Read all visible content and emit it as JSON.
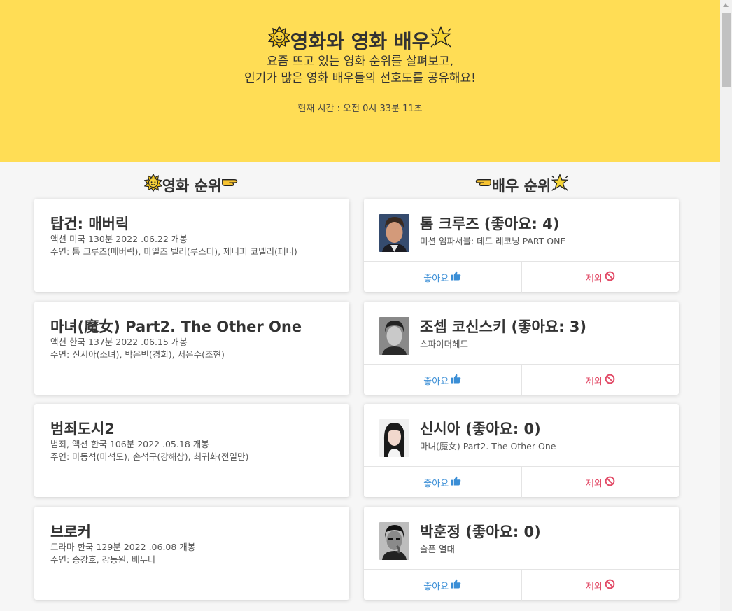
{
  "header": {
    "title": "영화와 영화 배우",
    "subtitle_line1": "요즘 뜨고 있는 영화 순위를 살펴보고,",
    "subtitle_line2": "인기가 많은 영화 배우들의 선호도를 공유해요!",
    "time_text": "현재 시간 : 오전 0시 33분 11초"
  },
  "movie_section": {
    "title": "영화 순위"
  },
  "actor_section": {
    "title": "배우 순위"
  },
  "movies": [
    {
      "title": "탑건: 매버릭",
      "info": "액션 미국 130분 2022 .06.22 개봉",
      "cast": "주연: 톰 크루즈(매버릭), 마일즈 텔러(루스터), 제니퍼 코넬리(페니)"
    },
    {
      "title": "마녀(魔女) Part2. The Other One",
      "info": "액션 한국 137분 2022 .06.15 개봉",
      "cast": "주연: 신시아(소녀), 박은빈(경희), 서은수(조현)"
    },
    {
      "title": "범죄도시2",
      "info": "범죄, 액션 한국 106분 2022 .05.18 개봉",
      "cast": "주연: 마동석(마석도), 손석구(강해상), 최귀화(전일만)"
    },
    {
      "title": "브로커",
      "info": "드라마 한국 129분 2022 .06.08 개봉",
      "cast": "주연: 송강호, 강동원, 배두나"
    }
  ],
  "actors": [
    {
      "name": "톰 크루즈 (좋아요: 4)",
      "movie": "미션 임파서블: 데드 레코닝 PART ONE"
    },
    {
      "name": "조셉 코신스키 (좋아요: 3)",
      "movie": "스파이더헤드"
    },
    {
      "name": "신시아 (좋아요: 0)",
      "movie": "마녀(魔女) Part2. The Other One"
    },
    {
      "name": "박훈정 (좋아요: 0)",
      "movie": "슬픈 열대"
    }
  ],
  "buttons": {
    "like_label": "좋아요",
    "exclude_label": "제외"
  },
  "icons": {
    "sun": "sun-face-icon",
    "star": "glowing-star-icon",
    "hand": "pointing-hand-icon",
    "like": "thumbs-up-icon",
    "exclude": "prohibited-icon"
  },
  "colors": {
    "hero_bg": "#ffdd55",
    "like": "#3a8ed6",
    "exclude": "#e24a66"
  }
}
